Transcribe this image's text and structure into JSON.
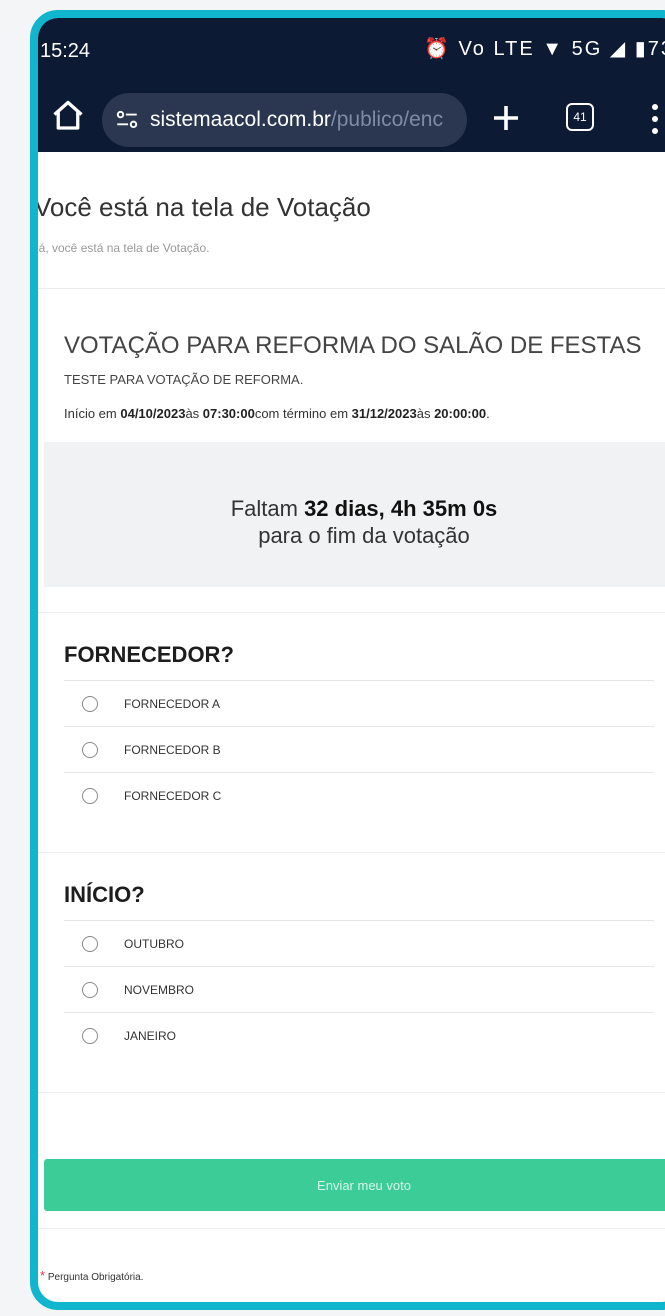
{
  "status_bar": {
    "time": "15:24",
    "icons_text": "⏰ Vo LTE ▼ 5G ◢ ▮73"
  },
  "browser": {
    "url_domain": "sistemaacol.com.br",
    "url_path": "/publico/enc",
    "tab_count": "41"
  },
  "page": {
    "title": "Você está na tela de Votação",
    "subtitle": "lá, você está na tela de Votação."
  },
  "voting": {
    "title": "VOTAÇÃO PARA REFORMA DO SALÃO DE FESTAS",
    "description": "TESTE PARA VOTAÇÃO DE REFORMA.",
    "period": {
      "start_prefix": "Início em ",
      "start_date": "04/10/2023",
      "at_1": "às ",
      "start_time": "07:30:00",
      "end_prefix": "com término em ",
      "end_date": "31/12/2023",
      "at_2": "às ",
      "end_time": "20:00:00",
      "end_suffix": "."
    },
    "countdown": {
      "prefix": "Faltam ",
      "remaining": "32 dias, 4h 35m 0s",
      "suffix": "para o fim da votação"
    }
  },
  "questions": [
    {
      "title": "FORNECEDOR?",
      "options": [
        "FORNECEDOR A",
        "FORNECEDOR B",
        "FORNECEDOR C"
      ]
    },
    {
      "title": "INÍCIO?",
      "options": [
        "OUTUBRO",
        "NOVEMBRO",
        "JANEIRO"
      ]
    }
  ],
  "submit_label": "Enviar meu voto",
  "required_note": {
    "star": "*",
    "text": "Pergunta Obrigatória."
  },
  "colors": {
    "frame": "#0fb6cd",
    "browser_bar": "#0d1a33",
    "submit_button": "#3ccc98",
    "required_star": "#e0314c"
  }
}
